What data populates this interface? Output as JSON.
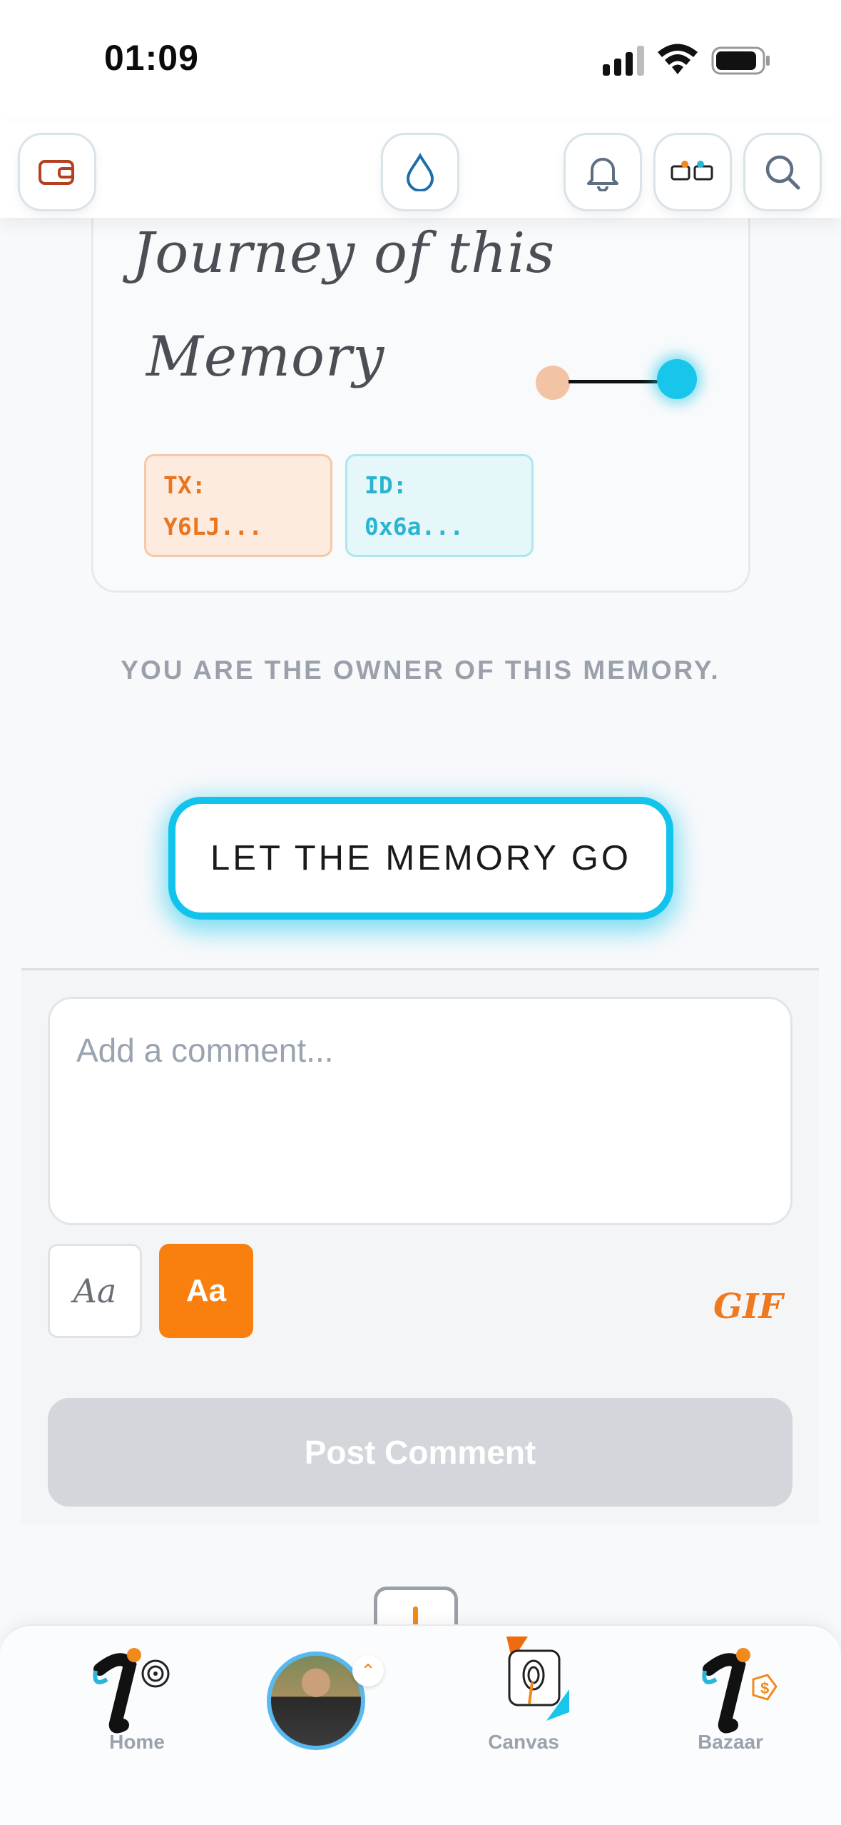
{
  "status_bar": {
    "time": "01:09"
  },
  "header": {
    "buttons": [
      "wallet-icon",
      "drop-icon",
      "bell-icon",
      "chat-icon",
      "search-icon"
    ]
  },
  "journey": {
    "title_line1": "Journey of this",
    "title_line2": "Memory",
    "tx_label": "TX:",
    "tx_value": "Y6LJ...",
    "id_label": "ID:",
    "id_value": "0x6a..."
  },
  "owner_text": "YOU ARE THE OWNER OF THIS MEMORY.",
  "let_go_button": "LET THE MEMORY GO",
  "comment": {
    "placeholder": "Add a comment...",
    "font_option_1": "Aa",
    "font_option_2": "Aa",
    "gif_label": "GIF",
    "post_button": "Post Comment"
  },
  "nav": {
    "items": [
      {
        "label": "Home"
      },
      {
        "label": ""
      },
      {
        "label": "Canvas"
      },
      {
        "label": "Bazaar"
      }
    ]
  },
  "colors": {
    "accent_cyan": "#12c4ec",
    "accent_orange": "#f9800f",
    "tx_text": "#e9751f",
    "id_text": "#2bb4d0"
  }
}
